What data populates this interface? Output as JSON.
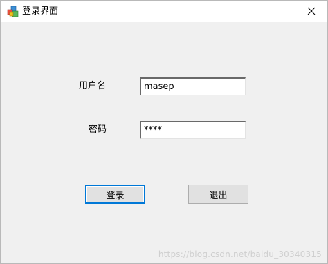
{
  "window": {
    "title": "登录界面",
    "icon": "app-icon",
    "close_icon": "close-icon"
  },
  "form": {
    "username_label": "用户名",
    "username_value": "masep",
    "password_label": "密码",
    "password_value": "****"
  },
  "buttons": {
    "login_label": "登录",
    "exit_label": "退出"
  },
  "watermark": "https://blog.csdn.net/baidu_30340315",
  "colors": {
    "background": "#f0f0f0",
    "titlebar": "#ffffff",
    "button_face": "#e1e1e1",
    "focus_border": "#0078d7"
  }
}
